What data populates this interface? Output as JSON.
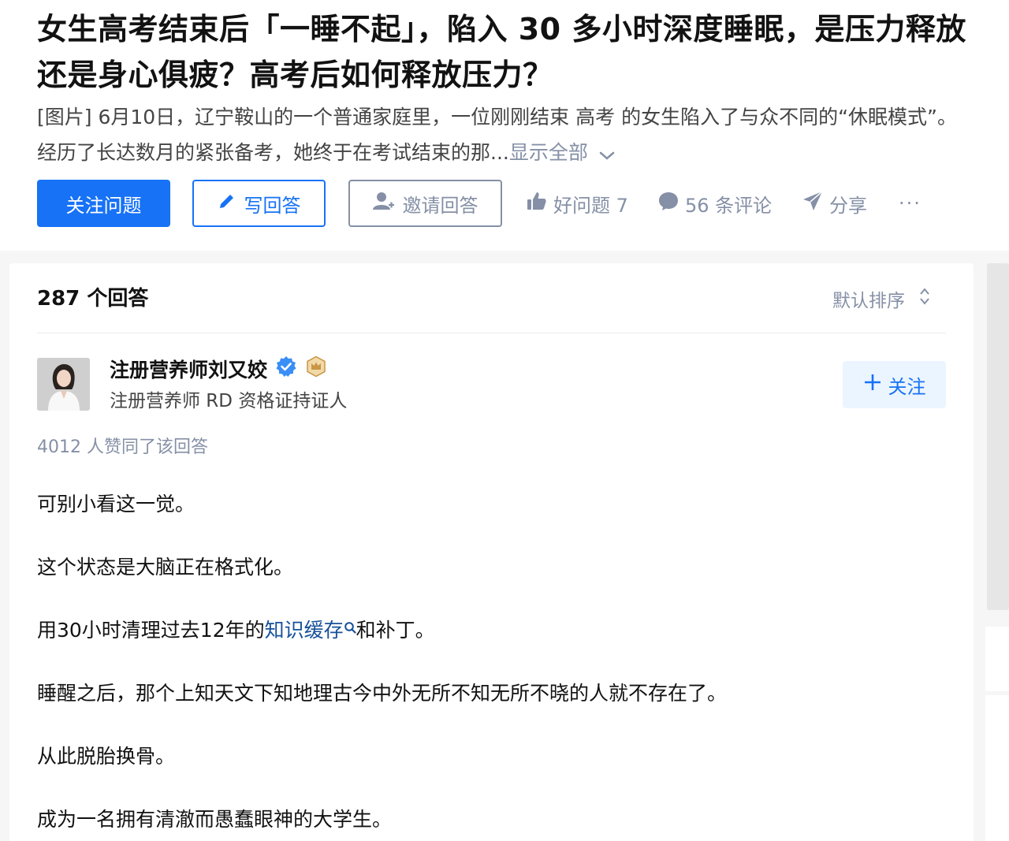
{
  "question": {
    "title": "女生高考结束后「一睡不起」，陷入 30 多小时深度睡眠，是压力释放还是身心俱疲？高考后如何释放压力？",
    "detail": "[图片] 6月10日，辽宁鞍山的一个普通家庭里，一位刚刚结束 高考 的女生陷入了与众不同的“休眠模式”。经历了长达数月的紧张备考，她终于在考试结束的那...",
    "show_all": "显示全部"
  },
  "actions": {
    "follow_question": "关注问题",
    "write_answer": "写回答",
    "invite_answer": "邀请回答",
    "good_question": "好问题 7",
    "comments": "56 条评论",
    "share": "分享",
    "more": "···"
  },
  "answers": {
    "count_label": "287 个回答",
    "sort_label": "默认排序"
  },
  "answer": {
    "author_name": "注册营养师刘又姣",
    "author_bio": "注册营养师 RD 资格证持证人",
    "follow_label": "关注",
    "votes_label": "4012 人赞同了该回答",
    "paragraphs": [
      "可别小看这一觉。",
      "这个状态是大脑正在格式化。",
      "睡醒之后，那个上知天文下知地理古今中外无所不知无所不晓的人就不存在了。",
      "从此脱胎换骨。",
      "成为一名拥有清澈而愚蠢眼神的大学生。"
    ],
    "p3_before": "用30小时清理过去12年的",
    "p3_keyword": "知识缓存",
    "p3_after": "和补丁。"
  },
  "colors": {
    "brand_blue": "#1772f6",
    "gray_text": "#8590a6",
    "keyword_link": "#175199"
  },
  "icons": [
    "pencil-icon",
    "invite-user-icon",
    "thumbs-up-icon",
    "comment-icon",
    "share-icon",
    "chevron-down-icon",
    "sort-icon",
    "verified-icon",
    "crown-badge-icon",
    "plus-icon",
    "search-icon"
  ]
}
